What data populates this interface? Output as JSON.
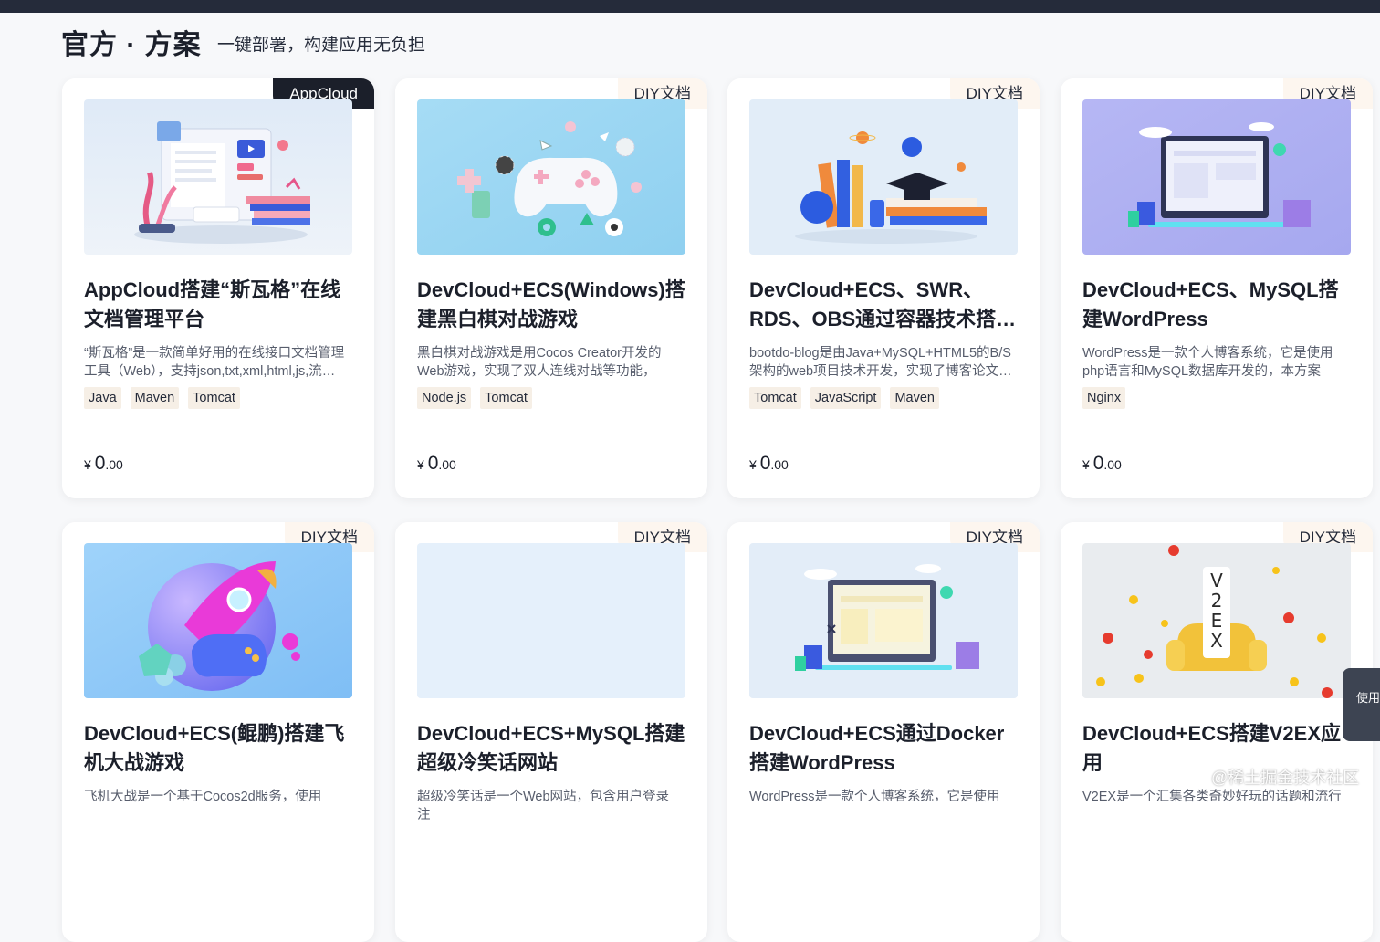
{
  "header": {
    "title": "官方 · 方案",
    "subtitle": "一键部署，构建应用无负担"
  },
  "cards": [
    {
      "badge": "AppCloud",
      "title": "AppCloud搭建“斯瓦格”在线文档管理平台",
      "desc": "“斯瓦格”是一款简单好用的在线接口文档管理工具（Web），支持json,txt,xml,html,js,流…",
      "tags": [
        "Java",
        "Maven",
        "Tomcat"
      ],
      "price_symbol": "¥",
      "price_int": "0",
      "price_dec": ".00"
    },
    {
      "badge": "DIY文档",
      "title": "DevCloud+ECS(Windows)搭建黑白棋对战游戏",
      "desc": "黑白棋对战游戏是用Cocos Creator开发的Web游戏，实现了双人连线对战等功能，主…",
      "tags": [
        "Node.js",
        "Tomcat"
      ],
      "price_symbol": "¥",
      "price_int": "0",
      "price_dec": ".00"
    },
    {
      "badge": "DIY文档",
      "title": "DevCloud+ECS、SWR、RDS、OBS通过容器技术搭…",
      "desc": "bootdo-blog是由Java+MySQL+HTML5的B/S架构的web项目技术开发，实现了博客论文…",
      "tags": [
        "Tomcat",
        "JavaScript",
        "Maven"
      ],
      "price_symbol": "¥",
      "price_int": "0",
      "price_dec": ".00"
    },
    {
      "badge": "DIY文档",
      "title": "DevCloud+ECS、MySQL搭建WordPress",
      "desc": "WordPress是一款个人博客系统，它是使用php语言和MySQL数据库开发的，本方案讲…",
      "tags": [
        "Nginx"
      ],
      "price_symbol": "¥",
      "price_int": "0",
      "price_dec": ".00"
    },
    {
      "badge": "DIY文档",
      "title": "DevCloud+ECS(鲲鹏)搭建飞机大战游戏",
      "desc": "飞机大战是一个基于Cocos2d服务，使用",
      "tags": [],
      "price_symbol": "",
      "price_int": "",
      "price_dec": ""
    },
    {
      "badge": "DIY文档",
      "title": "DevCloud+ECS+MySQL搭建超级冷笑话网站",
      "desc": "超级冷笑话是一个Web网站，包含用户登录注",
      "tags": [],
      "price_symbol": "",
      "price_int": "",
      "price_dec": ""
    },
    {
      "badge": "DIY文档",
      "title": "DevCloud+ECS通过Docker搭建WordPress",
      "desc": "WordPress是一款个人博客系统，它是使用",
      "tags": [],
      "price_symbol": "",
      "price_int": "",
      "price_dec": ""
    },
    {
      "badge": "DIY文档",
      "title": "DevCloud+ECS搭建V2EX应用",
      "desc": "V2EX是一个汇集各类奇妙好玩的话题和流行",
      "tags": [],
      "price_symbol": "",
      "price_int": "",
      "price_dec": ""
    }
  ],
  "thumb_art": {
    "v2ex_letters": [
      "V",
      "2",
      "E",
      "X"
    ]
  },
  "side_tab": {
    "label": "使用"
  },
  "watermark": "@稀土掘金技术社区",
  "colors": {
    "topbar": "#252b3a",
    "badge_dark": "#1b1f2a",
    "badge_light": "#fdf6ef",
    "tag_bg": "#f6efe6",
    "page_bg": "#f7f8fa"
  }
}
